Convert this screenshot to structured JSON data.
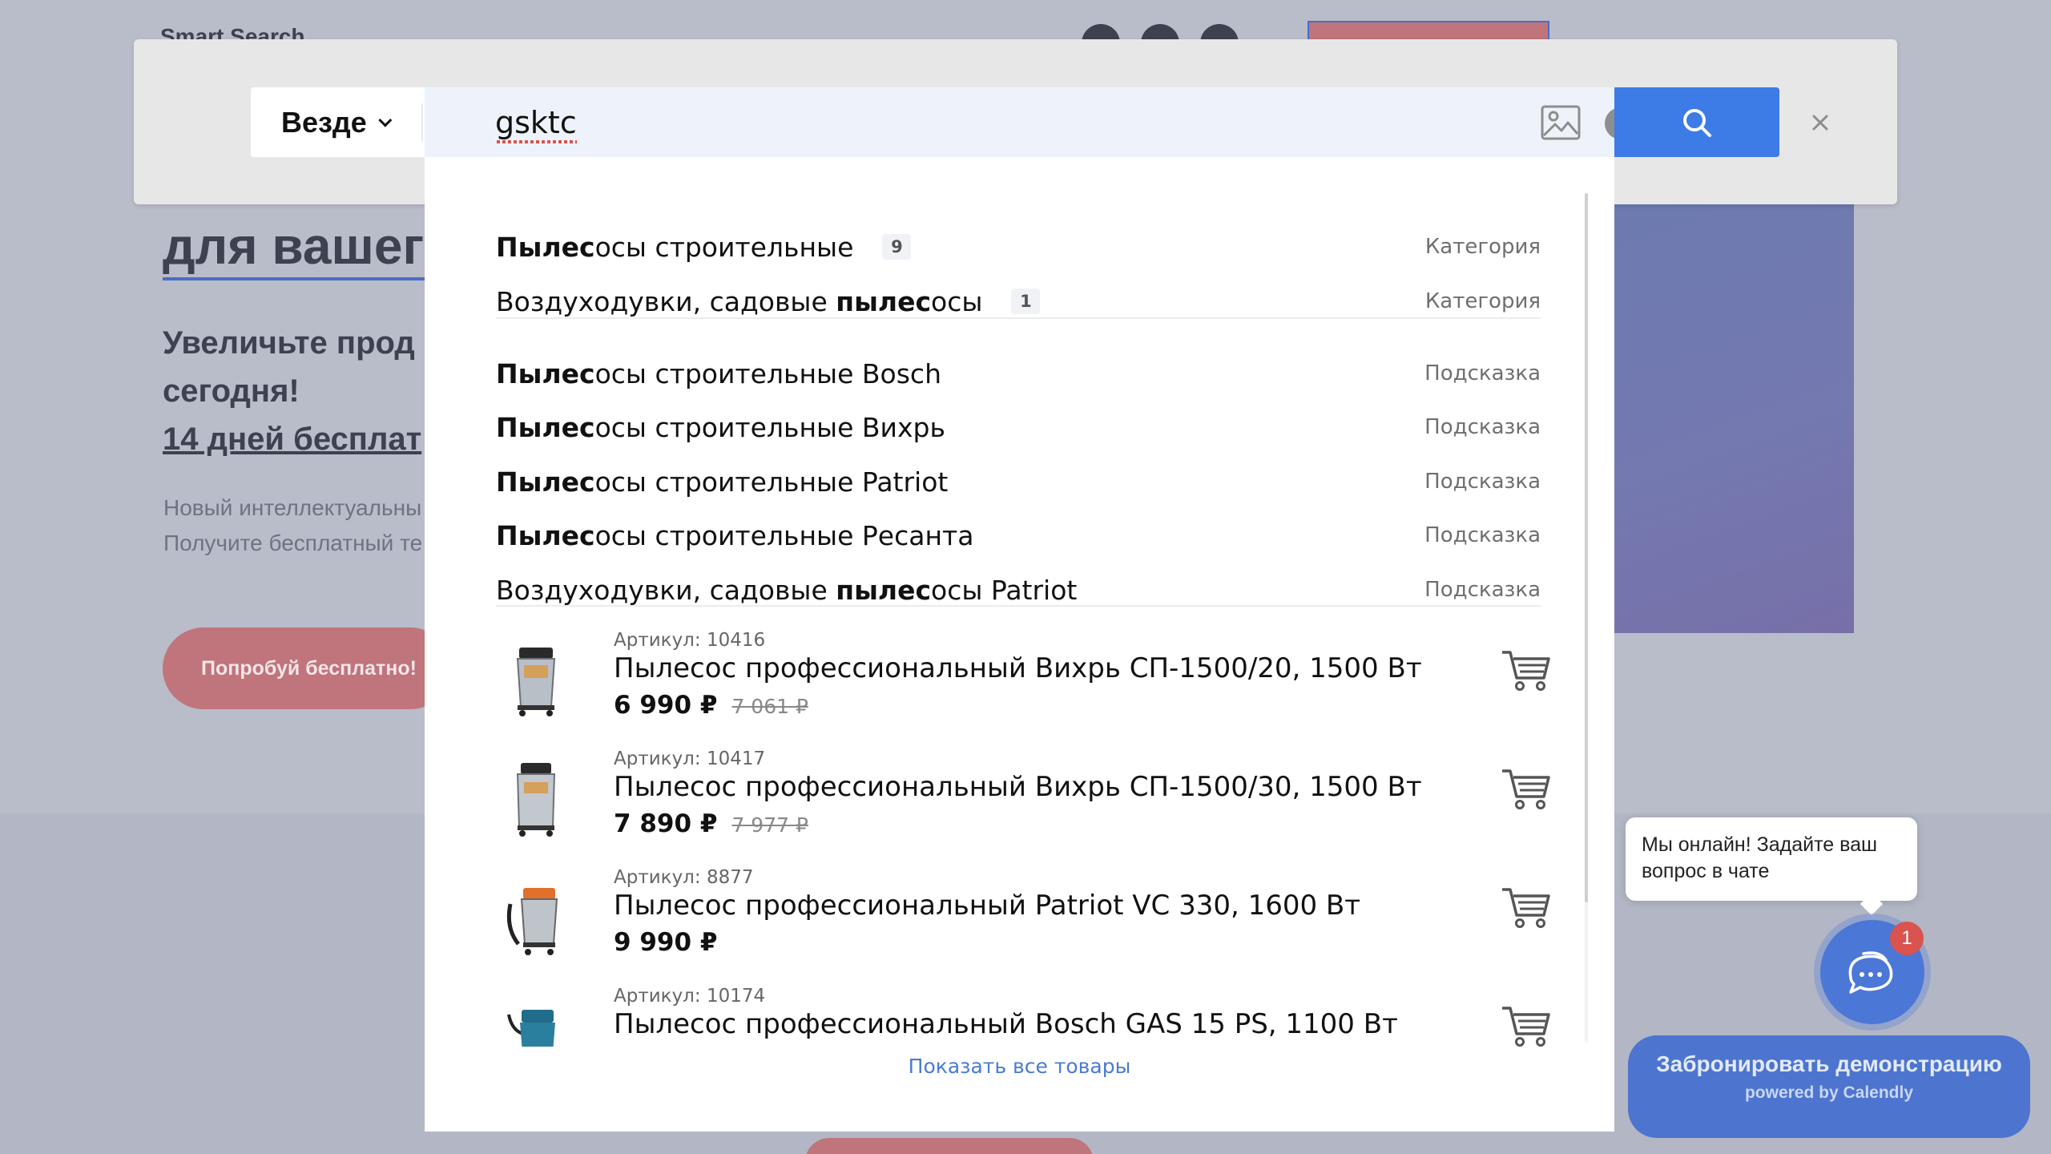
{
  "background": {
    "logo": "Smart Search",
    "heading": "для вашего",
    "subheading_line1": "Увеличьте прод",
    "subheading_line2": "сегодня!",
    "subheading_link": "14 дней бесплат",
    "desc_line1": "Новый интеллектуальны",
    "desc_line2": "Получите бесплатный те",
    "cta_label": "Попробуй бесплатно!"
  },
  "search": {
    "scope_label": "Везде",
    "query": "gsktc",
    "clear_label": "×",
    "close_label": "×"
  },
  "categories": [
    {
      "bold": "Пылес",
      "rest": "осы строительные",
      "count": "9",
      "type": "Категория"
    },
    {
      "prefix": "Воздуходувки, садовые ",
      "bold": "пылес",
      "rest": "осы",
      "count": "1",
      "type": "Категория"
    }
  ],
  "hints": [
    {
      "prefix": "",
      "bold": "Пылес",
      "rest": "осы строительные Bosch",
      "type": "Подсказка"
    },
    {
      "prefix": "",
      "bold": "Пылес",
      "rest": "осы строительные Вихрь",
      "type": "Подсказка"
    },
    {
      "prefix": "",
      "bold": "Пылес",
      "rest": "осы строительные Patriot",
      "type": "Подсказка"
    },
    {
      "prefix": "",
      "bold": "Пылес",
      "rest": "осы строительные Ресанта",
      "type": "Подсказка"
    },
    {
      "prefix": "Воздуходувки, садовые ",
      "bold": "пылес",
      "rest": "осы Patriot",
      "type": "Подсказка"
    }
  ],
  "products": [
    {
      "sku": "Артикул: 10416",
      "title": "Пылесос профессиональный Вихрь СП-1500/20, 1500 Вт",
      "price": "6 990 ₽",
      "old_price": "7 061 ₽",
      "image": "vacuum-steel-icon"
    },
    {
      "sku": "Артикул: 10417",
      "title": "Пылесос профессиональный Вихрь СП-1500/30, 1500 Вт",
      "price": "7 890 ₽",
      "old_price": "7 977 ₽",
      "image": "vacuum-steel-icon"
    },
    {
      "sku": "Артикул: 8877",
      "title": "Пылесос профессиональный Patriot VC 330, 1600 Вт",
      "price": "9 990 ₽",
      "old_price": "",
      "image": "vacuum-orange-icon"
    },
    {
      "sku": "Артикул: 10174",
      "title": "Пылесос профессиональный Bosch GAS 15 PS, 1100 Вт",
      "price": "",
      "old_price": "",
      "image": "vacuum-blue-icon"
    }
  ],
  "show_all_label": "Показать все товары",
  "chat": {
    "bubble_text": "Мы онлайн! Задайте ваш вопрос в чате",
    "badge": "1"
  },
  "calendly": {
    "main": "Забронировать демонстрацию",
    "sub": "powered by Calendly"
  },
  "colors": {
    "accent": "#3d7be6",
    "link": "#4a7ad4",
    "chat": "#4b77d6",
    "badge": "#d9534f"
  }
}
